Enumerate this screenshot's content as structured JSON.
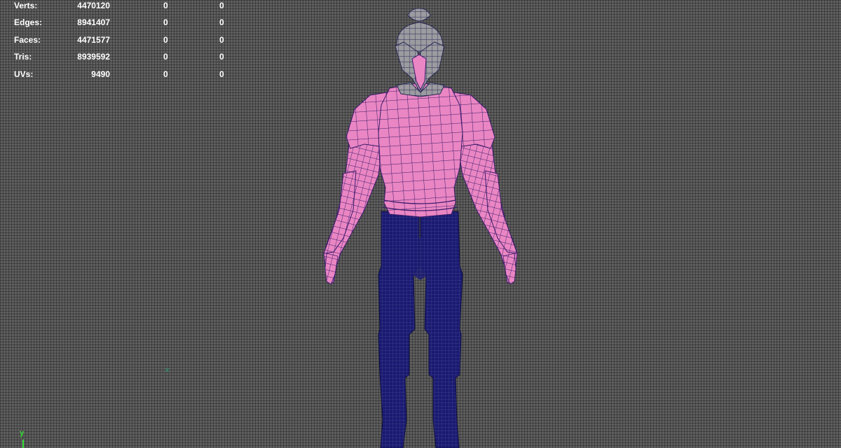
{
  "heads_up_display": {
    "rows": [
      {
        "label": "Verts:",
        "total": "4470120",
        "selected": "0",
        "component": "0"
      },
      {
        "label": "Edges:",
        "total": "8941407",
        "selected": "0",
        "component": "0"
      },
      {
        "label": "Faces:",
        "total": "4471577",
        "selected": "0",
        "component": "0"
      },
      {
        "label": "Tris:",
        "total": "8939592",
        "selected": "0",
        "component": "0"
      },
      {
        "label": "UVs:",
        "total": "9490",
        "selected": "0",
        "component": "0"
      }
    ]
  },
  "axis_indicator": {
    "label": "y",
    "color": "#34e034"
  },
  "colors": {
    "viewport_background": "#5f5f5f",
    "helmet": "#9b9ba0",
    "torso": "#ea86c3",
    "legs": "#1a1a72",
    "wireframe_helmet": "#2a2a55",
    "wireframe_torso": "#3a1a6a",
    "wireframe_legs": "#7070a8"
  }
}
